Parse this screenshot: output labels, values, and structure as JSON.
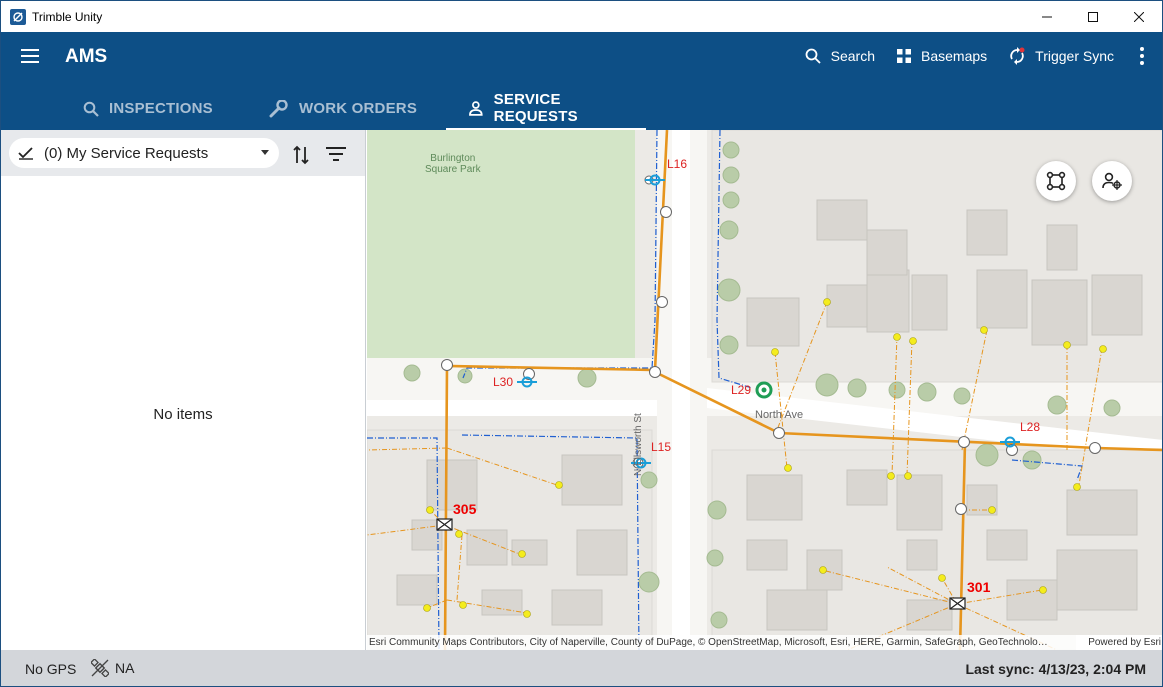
{
  "window": {
    "title": "Trimble Unity"
  },
  "header": {
    "app_title": "AMS",
    "actions": {
      "search": "Search",
      "basemaps": "Basemaps",
      "trigger_sync": "Trigger Sync"
    }
  },
  "tabs": [
    {
      "label": "INSPECTIONS",
      "icon": "search-icon"
    },
    {
      "label": "WORK ORDERS",
      "icon": "wrench-icon"
    },
    {
      "label": "SERVICE REQUESTS",
      "icon": "person-icon",
      "active": true
    }
  ],
  "list_panel": {
    "filter_selected": "(0) My Service Requests",
    "empty_text": "No items"
  },
  "map": {
    "labels": {
      "park": "Burlington\nSquare Park",
      "street_north": "North Ave",
      "street_ellsworth": "N Ellsworth St"
    },
    "line_labels": {
      "l16": "L16",
      "l30": "L30",
      "l29": "L29",
      "l15": "L15",
      "l28": "L28"
    },
    "station_labels": {
      "s305": "305",
      "s301": "301"
    },
    "attribution": "Esri Community Maps Contributors, City of Naperville, County of DuPage, © OpenStreetMap, Microsoft, Esri, HERE, Garmin, SafeGraph, GeoTechnolo…",
    "powered_by": "Powered by Esri"
  },
  "status": {
    "gps": "No GPS",
    "na": "NA",
    "last_sync": "Last sync: 4/13/23, 2:04 PM"
  },
  "colors": {
    "header": "#0d4f86",
    "utility_line": "#e6951e",
    "water_line": "#1f5fd1"
  }
}
